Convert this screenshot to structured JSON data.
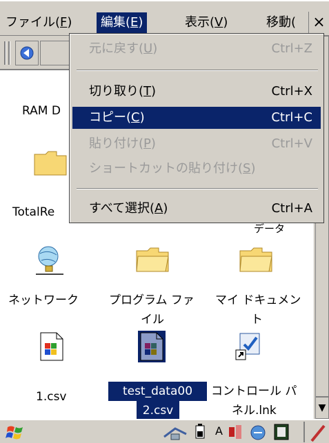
{
  "menubar": {
    "items": [
      {
        "label": "ファイル(",
        "mnemonic": "F",
        "suffix": ")"
      },
      {
        "label": "編集(",
        "mnemonic": "E",
        "suffix": ")"
      },
      {
        "label": "表示(",
        "mnemonic": "V",
        "suffix": ")"
      },
      {
        "label": "移動(",
        "mnemonic": "",
        "suffix": ""
      }
    ],
    "close_label": "×"
  },
  "edit_menu": {
    "items": [
      {
        "label": "元に戻す(",
        "mnemonic": "U",
        "suffix": ")",
        "shortcut": "Ctrl+Z",
        "state": "disabled"
      },
      {
        "label": "切り取り(",
        "mnemonic": "T",
        "suffix": ")",
        "shortcut": "Ctrl+X",
        "state": "enabled"
      },
      {
        "label": "コピー(",
        "mnemonic": "C",
        "suffix": ")",
        "shortcut": "Ctrl+C",
        "state": "highlighted"
      },
      {
        "label": "貼り付け(",
        "mnemonic": "P",
        "suffix": ")",
        "shortcut": "Ctrl+V",
        "state": "disabled"
      },
      {
        "label": "ショートカットの貼り付け(",
        "mnemonic": "S",
        "suffix": ")",
        "shortcut": "",
        "state": "disabled"
      },
      {
        "label": "すべて選択(",
        "mnemonic": "A",
        "suffix": ")",
        "shortcut": "Ctrl+A",
        "state": "enabled"
      }
    ]
  },
  "desktop": {
    "partial_labels": {
      "ram": "RAM D",
      "total": "TotalRe",
      "data": "データ"
    },
    "icons": [
      {
        "label": "ネットワーク",
        "icon": "network-icon"
      },
      {
        "label_line1": "プログラム ファ",
        "label_line2": "イル",
        "icon": "folder-icon"
      },
      {
        "label_line1": "マイ ドキュメン",
        "label_line2": "ト",
        "icon": "folder-icon"
      },
      {
        "label": "1.csv",
        "icon": "csv-file-icon"
      },
      {
        "label_line1": "test_data00",
        "label_line2": "2.csv",
        "icon": "csv-file-icon",
        "selected": true
      },
      {
        "label_line1": "コントロール パ",
        "label_line2": "ネル.lnk",
        "icon": "control-panel-shortcut-icon"
      }
    ]
  },
  "taskbar": {
    "tray_text": "A"
  },
  "colors": {
    "highlight": "#0a246a",
    "face": "#d4d0c8",
    "folder": "#f7d774"
  }
}
